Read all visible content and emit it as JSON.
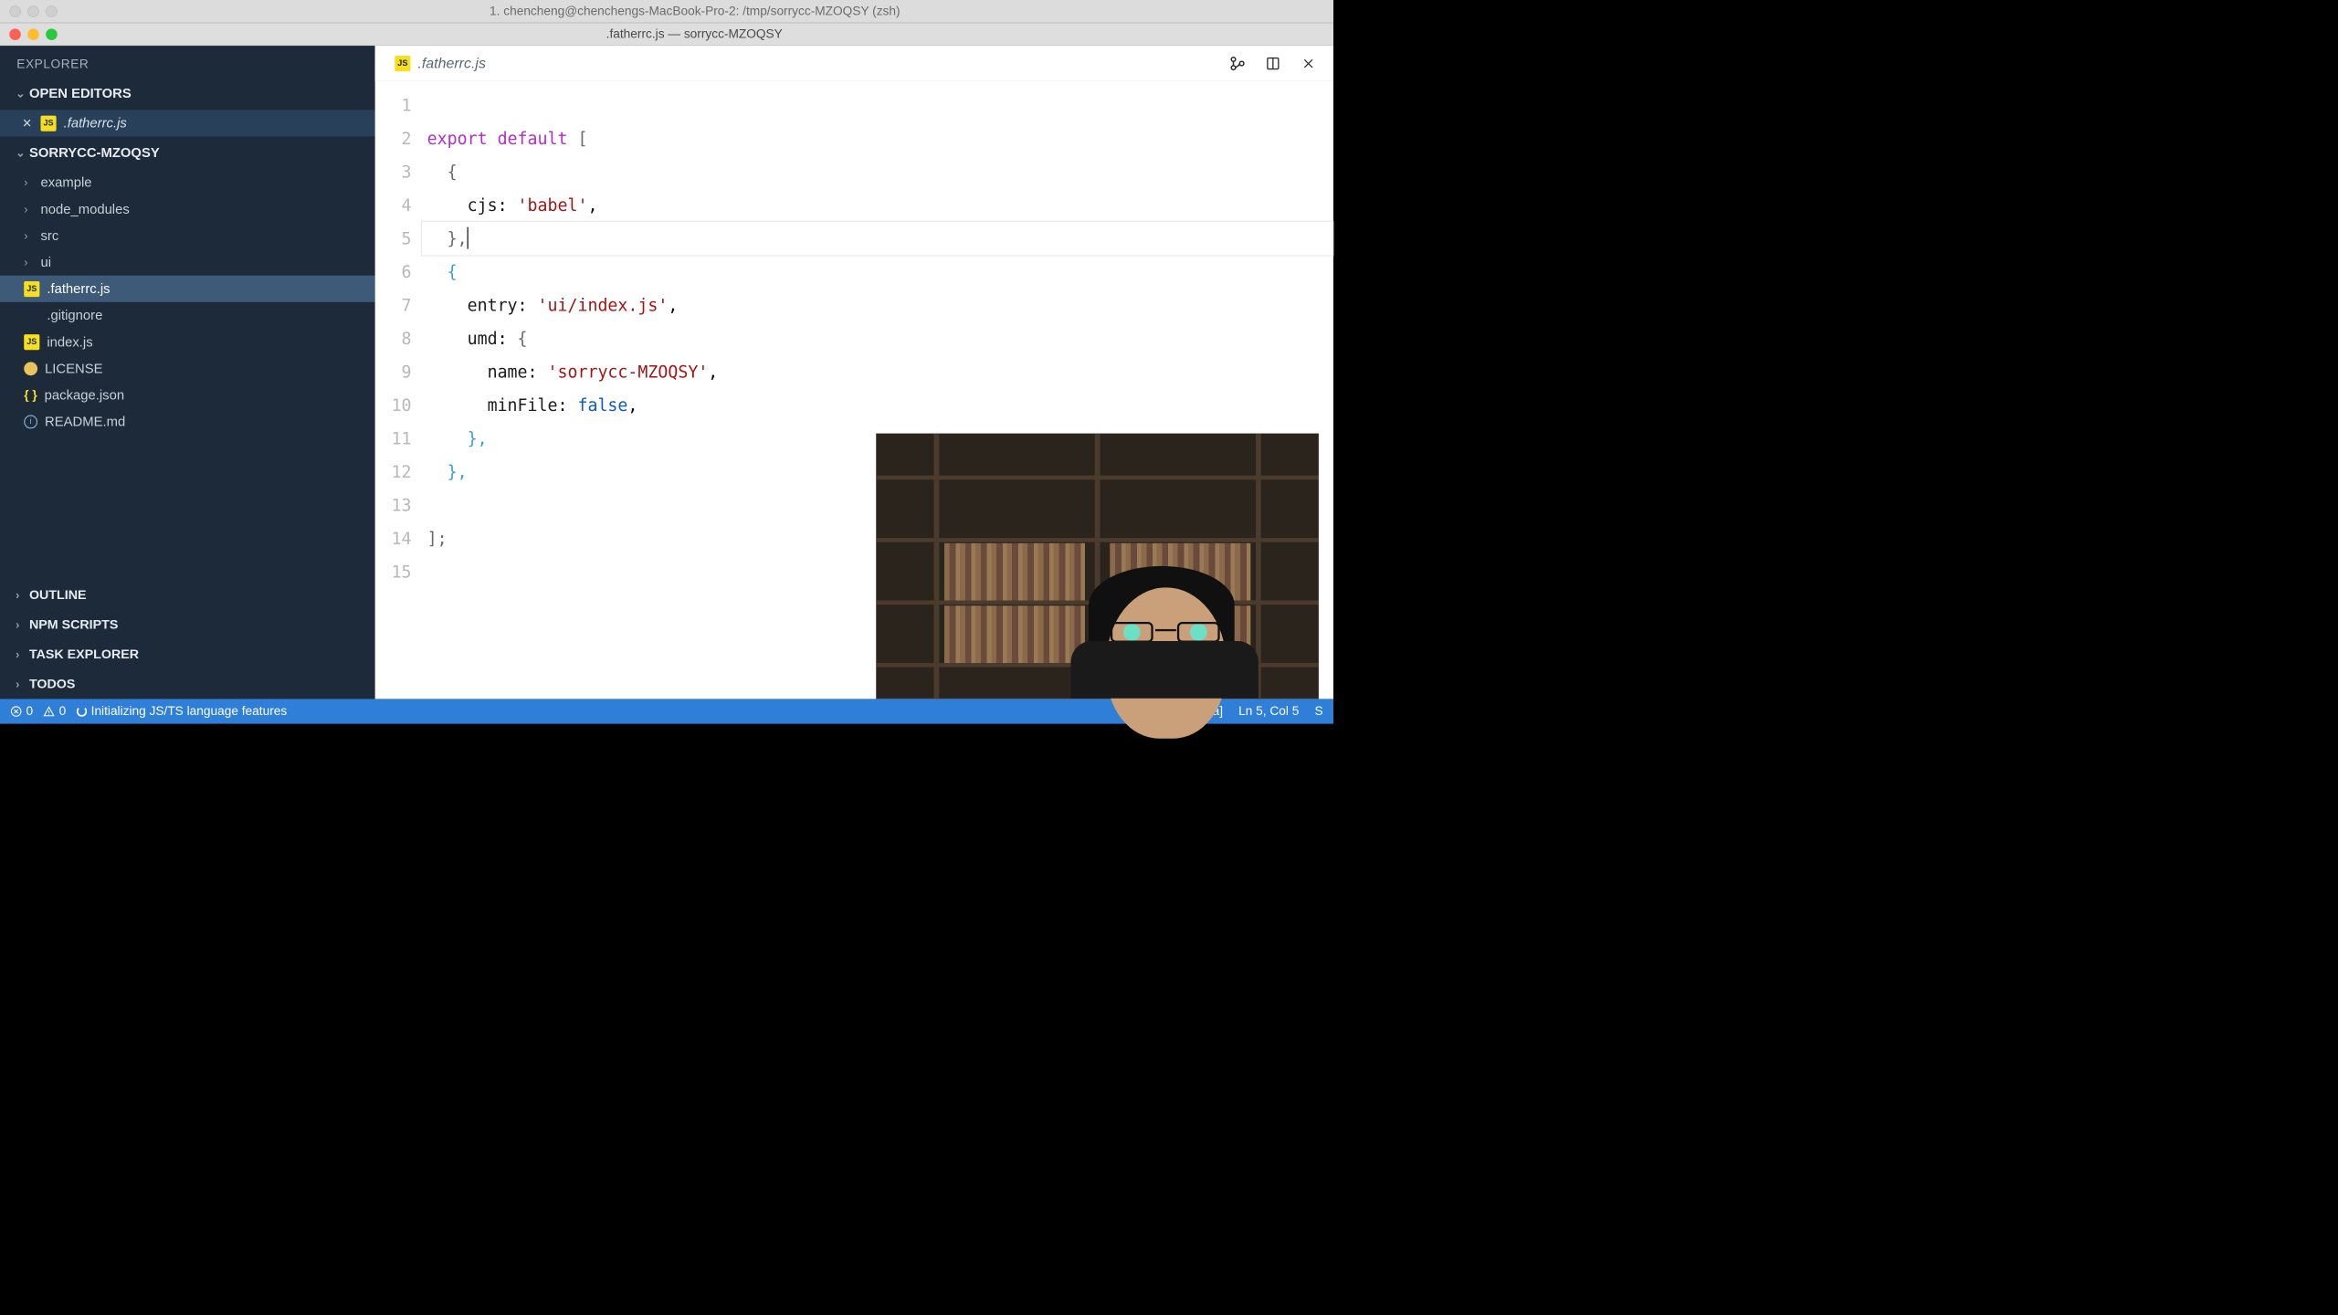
{
  "macos": {
    "title": "1. chencheng@chenchengs-MacBook-Pro-2: /tmp/sorrycc-MZOQSY (zsh)"
  },
  "window": {
    "title": ".fatherrc.js — sorrycc-MZOQSY"
  },
  "sidebar": {
    "header": "EXPLORER",
    "open_editors_label": "OPEN EDITORS",
    "project_label": "SORRYCC-MZOQSY",
    "open_editor": {
      "name": ".fatherrc.js"
    },
    "tree": {
      "folders": [
        "example",
        "node_modules",
        "src",
        "ui"
      ],
      "files": [
        {
          "name": ".fatherrc.js",
          "icon": "js",
          "selected": true
        },
        {
          "name": ".gitignore",
          "icon": "none"
        },
        {
          "name": "index.js",
          "icon": "js"
        },
        {
          "name": "LICENSE",
          "icon": "license"
        },
        {
          "name": "package.json",
          "icon": "json"
        },
        {
          "name": "README.md",
          "icon": "md"
        }
      ]
    },
    "panels": [
      "OUTLINE",
      "NPM SCRIPTS",
      "TASK EXPLORER",
      "TODOS"
    ]
  },
  "editor": {
    "tab": {
      "filename": ".fatherrc.js"
    },
    "line_numbers": [
      "1",
      "2",
      "3",
      "4",
      "5",
      "6",
      "7",
      "8",
      "9",
      "10",
      "11",
      "12",
      "13",
      "14",
      "15"
    ],
    "code": {
      "l2_export": "export",
      "l2_default": "default",
      "l2_open": "[",
      "l3_open": "{",
      "l4_key": "cjs",
      "l4_val": "'babel'",
      "l5_close": "},",
      "l6_open": "{",
      "l7_key": "entry",
      "l7_val": "'ui/index.js'",
      "l8_key": "umd",
      "l8_open": "{",
      "l9_key": "name",
      "l9_val": "'sorrycc-MZOQSY'",
      "l10_key": "minFile",
      "l10_val": "false",
      "l11_close": "},",
      "l12_close": "},",
      "l14_close": "];"
    },
    "cursor": {
      "line": 5,
      "label": "Ln 5, Col 5"
    }
  },
  "statusbar": {
    "errors": "0",
    "warnings": "0",
    "initializing": "Initializing JS/TS language features",
    "match_case": "[Aa]",
    "cursor": "Ln 5, Col 5",
    "right_partial": "S"
  }
}
